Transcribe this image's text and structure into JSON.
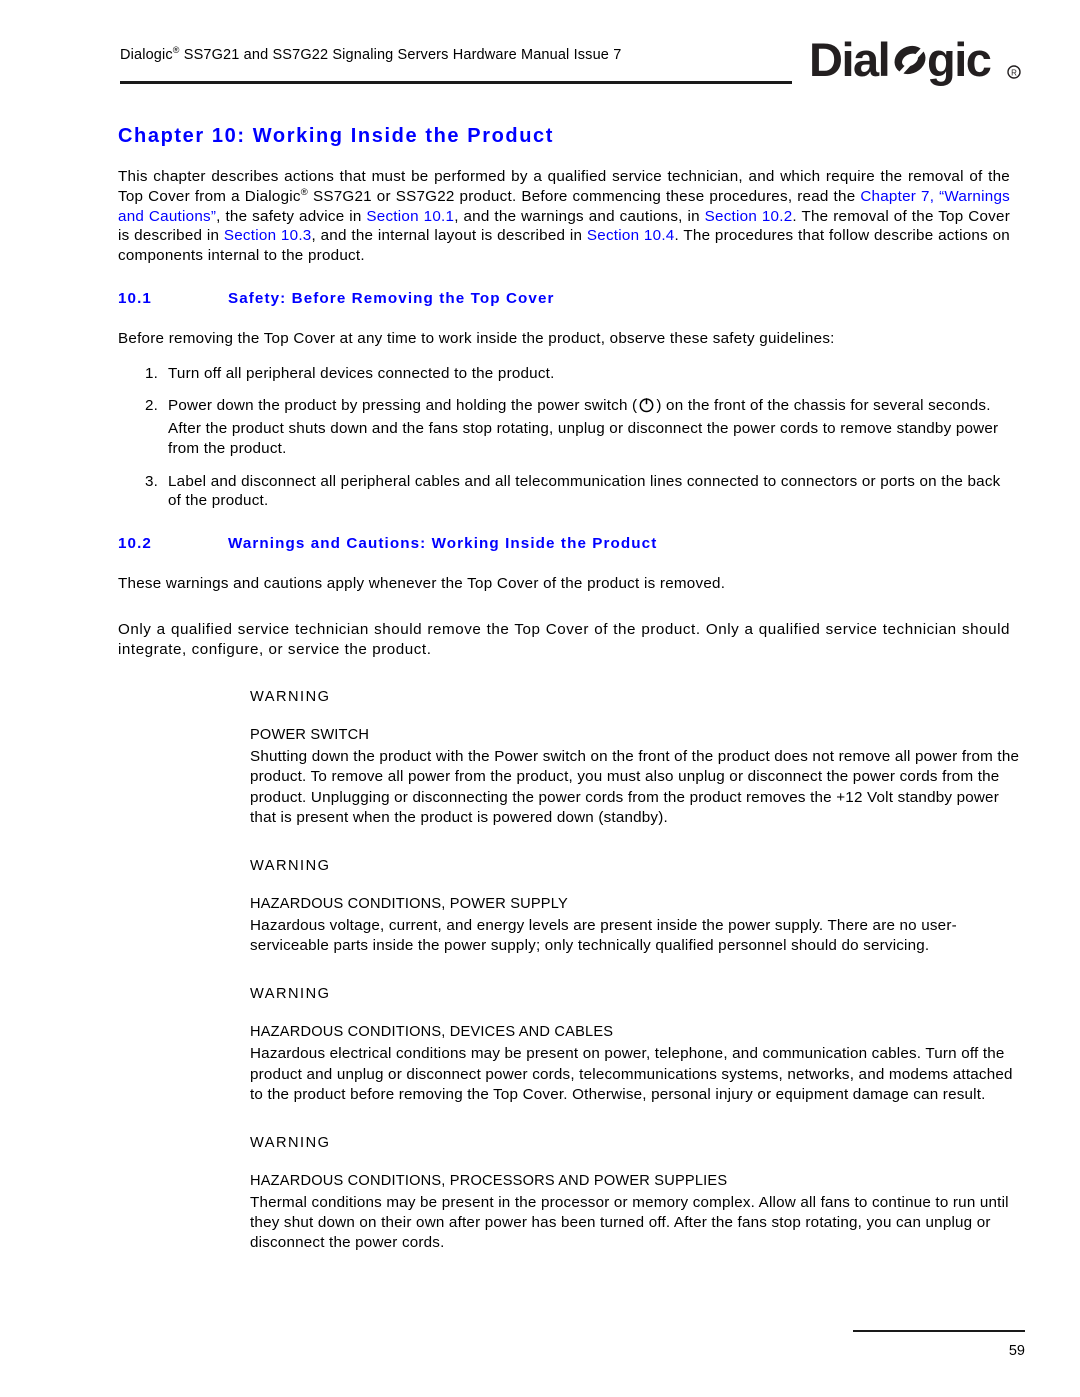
{
  "header": {
    "running_head_pre": "Dialogic",
    "running_head_sup": "®",
    "running_head_post": " SS7G21 and SS7G22 Signaling Servers Hardware Manual  Issue 7",
    "logo_text": "Dialogic",
    "logo_mark": "registered-trademark"
  },
  "chapter": {
    "title": "Chapter 10:  Working Inside the Product"
  },
  "intro": {
    "seg1": "This chapter describes actions that must be performed by a qualified service technician, and which require the removal of the Top Cover from a Dialogic",
    "sup": "®",
    "seg2": " SS7G21 or SS7G22 product. Before commencing these procedures, read the ",
    "link1": "Chapter 7, “Warnings and Cautions”",
    "seg3": ", the safety advice in ",
    "link2": "Section 10.1",
    "seg4": ", and the warnings and cautions, in ",
    "link3": "Section 10.2",
    "seg5": ". The removal of the Top Cover is described in ",
    "link4": "Section 10.3",
    "seg6": ", and the internal layout is described in ",
    "link5": "Section 10.4",
    "seg7": ". The procedures that follow describe actions on components internal to the product."
  },
  "section_10_1": {
    "number": "10.1",
    "title": "Safety: Before Removing the Top Cover",
    "intro": "Before removing the Top Cover at any time to work inside the product, observe these safety guidelines:",
    "items": [
      {
        "text": "Turn off all peripheral devices connected to the product."
      },
      {
        "text_before": "Power down the product by pressing and holding the power switch (",
        "icon": "power-switch-icon",
        "text_after": ") on the front of the chassis for several seconds. After the product shuts down and the fans stop rotating, unplug or disconnect the power cords to remove standby power from the product."
      },
      {
        "text": "Label and disconnect all peripheral cables and all telecommunication lines connected to connectors or ports on the back of the product."
      }
    ]
  },
  "section_10_2": {
    "number": "10.2",
    "title": "Warnings and Cautions: Working Inside the Product",
    "intro": "These warnings and cautions apply whenever the Top Cover of the product is removed.",
    "qualification": "Only a qualified service technician should remove the Top Cover of the product. Only a qualified service technician should integrate, configure, or service the product.",
    "warnings": [
      {
        "label": "WARNING",
        "subject": "POWER SWITCH",
        "body": "Shutting down the product with the Power switch on the front of the product does not remove all power from the product. To remove all power from the product, you must also unplug or disconnect the power cords from the product. Unplugging or disconnecting the power cords from the product removes the +12 Volt standby power that is present when the product is powered down (standby)."
      },
      {
        "label": "WARNING",
        "subject": "HAZARDOUS CONDITIONS, POWER SUPPLY",
        "body": "Hazardous voltage, current, and energy levels are present inside the power supply. There are no user-serviceable parts inside the power supply; only technically qualified personnel should do servicing."
      },
      {
        "label": "WARNING",
        "subject": "HAZARDOUS CONDITIONS, DEVICES AND CABLES",
        "body": "Hazardous electrical conditions may be present on power, telephone, and communication cables. Turn off the product and unplug or disconnect power cords, telecommunications systems, networks, and modems attached to the product before removing the Top Cover. Otherwise, personal injury or equipment damage can result."
      },
      {
        "label": "WARNING",
        "subject": "HAZARDOUS CONDITIONS, PROCESSORS AND POWER SUPPLIES",
        "body": "Thermal conditions may be present in the processor or memory complex. Allow all fans to continue to run until they shut down on their own after power has been turned off. After the fans stop rotating, you can unplug or disconnect the power cords."
      }
    ]
  },
  "footer": {
    "page_number": "59"
  },
  "colors": {
    "link": "#0000ff",
    "heading": "#0000ff",
    "text": "#000000",
    "rule": "#1a1a1a"
  }
}
